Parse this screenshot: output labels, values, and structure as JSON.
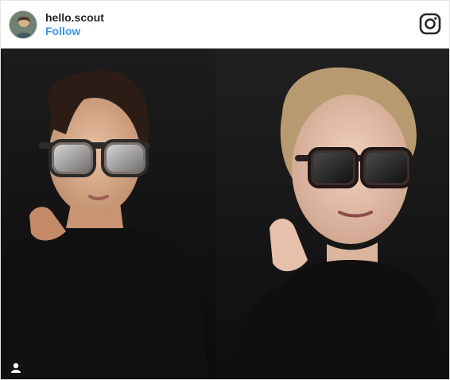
{
  "post": {
    "username": "hello.scout",
    "follow_label": "Follow"
  },
  "icons": {
    "avatar": "profile-avatar",
    "logo": "instagram-logo-icon",
    "user_tag": "user-tag-icon"
  },
  "colors": {
    "follow": "#3897f0",
    "username": "#262626",
    "photo_background": "#111111"
  }
}
